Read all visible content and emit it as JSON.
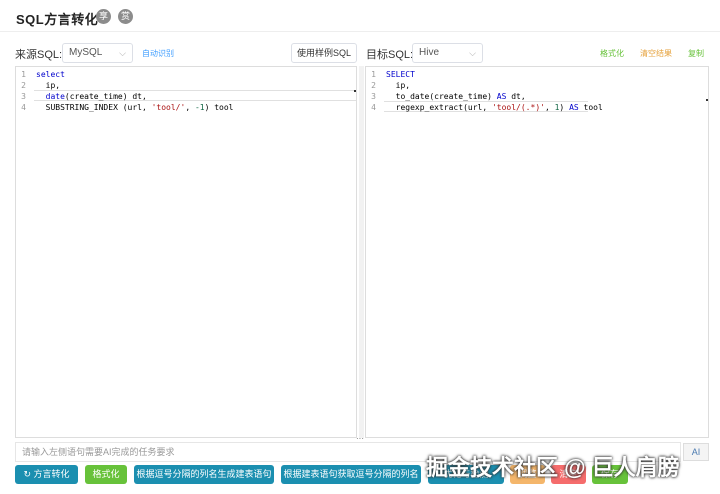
{
  "header": {
    "title": "SQL方言转化",
    "icon1": "享",
    "icon2": "赏"
  },
  "source": {
    "label": "来源SQL:",
    "dialect": "MySQL",
    "auto_detect": "自动识别",
    "sample_button": "使用样例SQL",
    "lines": [
      "1",
      "2",
      "3",
      "4"
    ]
  },
  "target": {
    "label": "目标SQL:",
    "dialect": "Hive",
    "format": "格式化",
    "clear": "清空结果",
    "copy": "复制",
    "lines": [
      "1",
      "2",
      "3",
      "4"
    ]
  },
  "ai": {
    "placeholder": "请输入左侧语句需要AI完成的任务要求",
    "icon": "AI"
  },
  "buttons": {
    "convert": "方言转化",
    "format": "格式化",
    "gen_create": "根据逗号分隔的列名生成建表语句",
    "get_columns": "根据建表语句获取逗号分隔的列名",
    "b5": "优化与检测",
    "b6": "调整",
    "b7": "清空",
    "b8": "保存"
  },
  "watermark": "掘金技术社区 @ 巨人肩膀",
  "colors": {
    "primary": "#1b8fb0",
    "success": "#67c23a",
    "danger": "#f56c6c",
    "link": "#409eff",
    "format_link": "#67c23a",
    "clear_link": "#e6a23c"
  }
}
